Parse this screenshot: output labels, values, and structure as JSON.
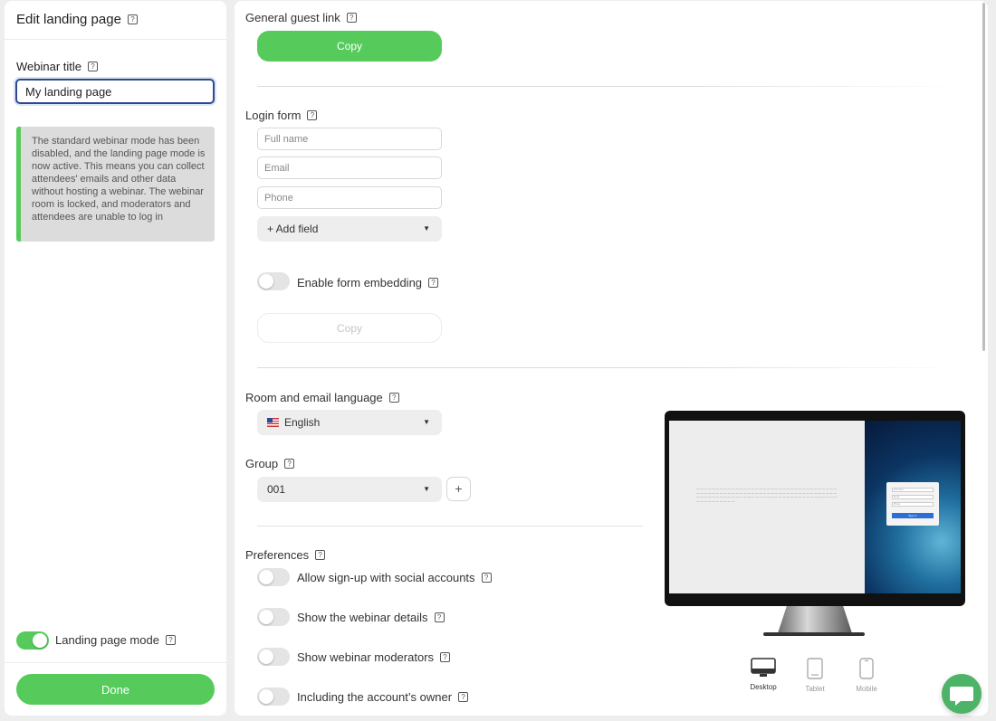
{
  "sidebar": {
    "title": "Edit landing page",
    "webinar_title_label": "Webinar title",
    "webinar_title_value": "My landing page",
    "notice": "The standard webinar mode has been disabled, and the landing page mode is now active. This means you can collect attendees' emails and other data without hosting a webinar. The webinar room is locked, and moderators and attendees are unable to log in",
    "landing_mode_label": "Landing page mode",
    "landing_mode_on": true,
    "done_label": "Done"
  },
  "main": {
    "guest_link_label": "General guest link",
    "copy_label": "Copy",
    "login_form_label": "Login form",
    "fields": {
      "full_name": "Full name",
      "email": "Email",
      "phone": "Phone"
    },
    "add_field_label": "+ Add field",
    "embedding_label": "Enable form embedding",
    "embed_copy_label": "Copy",
    "language_label": "Room and email language",
    "language_value": "English",
    "group_label": "Group",
    "group_value": "001",
    "group_add": "+",
    "preferences_label": "Preferences",
    "preferences": [
      {
        "label": "Allow sign-up with social accounts",
        "on": false
      },
      {
        "label": "Show the webinar details",
        "on": false
      },
      {
        "label": "Show webinar moderators",
        "on": false
      },
      {
        "label": "Including the account’s owner",
        "on": false
      }
    ]
  },
  "preview": {
    "devices": [
      "Desktop",
      "Tablet",
      "Mobile"
    ],
    "active_device": "Desktop",
    "mini_form": {
      "fields": [
        "Full name",
        "Email",
        "Phone"
      ],
      "button": "Sign in"
    }
  },
  "help_glyph": "?",
  "colors": {
    "accent": "#56cb5c",
    "input_focus_border": "#2c4b8f",
    "chat_button": "#4db366"
  }
}
